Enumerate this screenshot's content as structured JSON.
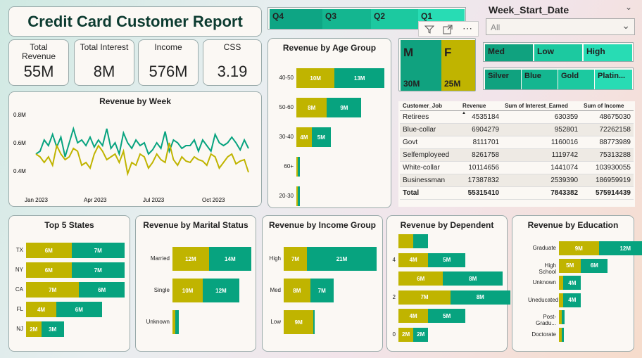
{
  "title": "Credit Card Customer Report",
  "colors": {
    "gold": "#c0b400",
    "teal": "#07a37f"
  },
  "kpis": [
    {
      "label": "Total Revenue",
      "value": "55M"
    },
    {
      "label": "Total Interest",
      "value": "8M"
    },
    {
      "label": "Income",
      "value": "576M"
    },
    {
      "label": "CSS",
      "value": "3.19"
    }
  ],
  "quarters": [
    "Q4",
    "Q3",
    "Q2",
    "Q1"
  ],
  "gender": {
    "m_label": "M",
    "m_value": "30M",
    "f_label": "F",
    "f_value": "25M"
  },
  "visual_header_icons": [
    "filter-icon",
    "focus-mode-icon",
    "more-options-icon"
  ],
  "week_slicer": {
    "title": "Week_Start_Date",
    "selected": "All"
  },
  "income_group_slicer": [
    "Med",
    "Low",
    "High"
  ],
  "card_category_slicer": [
    "Silver",
    "Blue",
    "Gold",
    "Platin..."
  ],
  "table": {
    "headers": [
      "Customer_Job",
      "Revenue",
      "Sum of Interest_Earned",
      "Sum of Income"
    ],
    "rows": [
      [
        "Retirees",
        "4535184",
        "630359",
        "48675030"
      ],
      [
        "Blue-collar",
        "6904279",
        "952801",
        "72262158"
      ],
      [
        "Govt",
        "8111701",
        "1160016",
        "88773989"
      ],
      [
        "Selfemployeed",
        "8261758",
        "1119742",
        "75313288"
      ],
      [
        "White-collar",
        "10114656",
        "1441074",
        "103930055"
      ],
      [
        "Businessman",
        "17387832",
        "2539390",
        "186959919"
      ]
    ],
    "total": [
      "Total",
      "55315410",
      "7843382",
      "575914439"
    ]
  },
  "chart_data": [
    {
      "type": "line",
      "title": "Revenue by Week",
      "x_ticks": [
        "Jan 2023",
        "Apr 2023",
        "Jul 2023",
        "Oct 2023"
      ],
      "y_ticks": [
        "0.8M",
        "0.6M",
        "0.4M"
      ],
      "ylim": [
        0.35,
        0.82
      ],
      "series": [
        {
          "values": [
            0.52,
            0.54,
            0.62,
            0.58,
            0.66,
            0.57,
            0.64,
            0.5,
            0.6,
            0.7,
            0.6,
            0.62,
            0.58,
            0.64,
            0.57,
            0.62,
            0.58,
            0.7,
            0.56,
            0.6,
            0.52,
            0.67,
            0.6,
            0.56,
            0.62,
            0.58,
            0.6,
            0.52,
            0.55,
            0.6,
            0.56,
            0.68,
            0.54,
            0.62,
            0.6,
            0.56,
            0.58,
            0.58,
            0.62,
            0.54,
            0.62,
            0.58,
            0.54,
            0.66,
            0.6,
            0.58,
            0.6,
            0.64,
            0.6,
            0.55,
            0.62,
            0.56
          ]
        },
        {
          "values": [
            0.52,
            0.5,
            0.46,
            0.5,
            0.44,
            0.58,
            0.52,
            0.48,
            0.5,
            0.56,
            0.54,
            0.44,
            0.46,
            0.42,
            0.52,
            0.58,
            0.54,
            0.48,
            0.5,
            0.52,
            0.46,
            0.54,
            0.38,
            0.46,
            0.44,
            0.52,
            0.5,
            0.42,
            0.46,
            0.52,
            0.48,
            0.46,
            0.6,
            0.48,
            0.44,
            0.5,
            0.47,
            0.46,
            0.5,
            0.48,
            0.47,
            0.44,
            0.52,
            0.5,
            0.42,
            0.46,
            0.5,
            0.52,
            0.45,
            0.47,
            0.48,
            0.39
          ]
        }
      ]
    },
    {
      "type": "bar",
      "title": "Revenue by Age Group",
      "categories": [
        "40-50",
        "50-60",
        "30-40",
        "60+",
        "20-30"
      ],
      "series": [
        {
          "values": [
            10,
            8,
            4,
            0.4,
            0.4
          ],
          "labels": [
            "10M",
            "8M",
            "4M",
            "",
            ""
          ]
        },
        {
          "values": [
            13,
            9,
            5,
            0.6,
            0.5
          ],
          "labels": [
            "13M",
            "9M",
            "5M",
            "",
            ""
          ]
        }
      ],
      "max": 23
    },
    {
      "type": "bar",
      "title": "Top 5 States",
      "categories": [
        "TX",
        "NY",
        "CA",
        "FL",
        "NJ"
      ],
      "series": [
        {
          "values": [
            6,
            6,
            7,
            4,
            2
          ],
          "labels": [
            "6M",
            "6M",
            "7M",
            "4M",
            "2M"
          ]
        },
        {
          "values": [
            7,
            7,
            6,
            6,
            3
          ],
          "labels": [
            "7M",
            "7M",
            "6M",
            "6M",
            "3M"
          ]
        }
      ],
      "max": 13
    },
    {
      "type": "bar",
      "title": "Revenue by Marital Status",
      "categories": [
        "Married",
        "Single",
        "Unknown"
      ],
      "series": [
        {
          "values": [
            12,
            10,
            1
          ],
          "labels": [
            "12M",
            "10M",
            ""
          ]
        },
        {
          "values": [
            14,
            12,
            1
          ],
          "labels": [
            "14M",
            "12M",
            ""
          ]
        }
      ],
      "max": 26
    },
    {
      "type": "bar",
      "title": "Revenue by Income Group",
      "categories": [
        "High",
        "Med",
        "Low"
      ],
      "series": [
        {
          "values": [
            7,
            8,
            9
          ],
          "labels": [
            "7M",
            "8M",
            "9M"
          ]
        },
        {
          "values": [
            21,
            7,
            0.3
          ],
          "labels": [
            "21M",
            "7M",
            ""
          ]
        }
      ],
      "max": 28
    },
    {
      "type": "bar",
      "title": "Revenue by Dependent",
      "categories": [
        "",
        "4",
        "",
        "2",
        "",
        "0"
      ],
      "series": [
        {
          "values": [
            2,
            4,
            6,
            7,
            4,
            2
          ],
          "labels": [
            "",
            "4M",
            "6M",
            "7M",
            "4M",
            "2M"
          ]
        },
        {
          "values": [
            2,
            5,
            8,
            8,
            5,
            2
          ],
          "labels": [
            "",
            "5M",
            "8M",
            "8M",
            "5M",
            "2M"
          ]
        }
      ],
      "max": 14
    },
    {
      "type": "bar",
      "title": "Revenue by Education",
      "categories": [
        "Graduate",
        "High School",
        "Unknown",
        "Uneducated",
        "Post-Gradu...",
        "Doctorate"
      ],
      "series": [
        {
          "values": [
            9,
            5,
            1,
            1,
            0.6,
            0.6
          ],
          "labels": [
            "9M",
            "5M",
            "",
            "",
            "",
            ""
          ]
        },
        {
          "values": [
            12,
            6,
            4,
            4,
            0.6,
            0.5
          ],
          "labels": [
            "12M",
            "6M",
            "4M",
            "4M",
            "",
            ""
          ]
        }
      ],
      "max": 21
    }
  ]
}
